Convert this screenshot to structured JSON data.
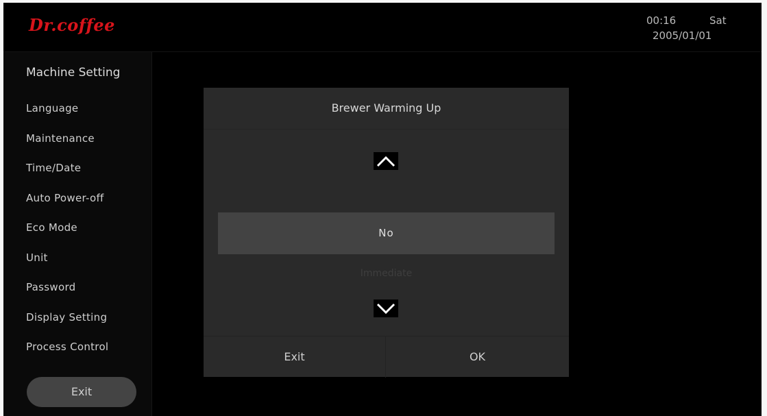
{
  "header": {
    "logo": "Dr.coffee",
    "time": "00:16",
    "day": "Sat",
    "date": "2005/01/01",
    "brand_color": "#d8141b"
  },
  "sidebar": {
    "title": "Machine Setting",
    "items": [
      {
        "label": "Language"
      },
      {
        "label": "Maintenance"
      },
      {
        "label": "Time/Date"
      },
      {
        "label": "Auto Power-off"
      },
      {
        "label": "Eco Mode"
      },
      {
        "label": "Unit"
      },
      {
        "label": "Password"
      },
      {
        "label": "Display Setting"
      },
      {
        "label": "Process Control"
      }
    ],
    "exit_label": "Exit"
  },
  "dialog": {
    "title": "Brewer Warming Up",
    "up_icon": "chevron-up-icon",
    "down_icon": "chevron-down-icon",
    "selected_value": "No",
    "next_option": "Immediate",
    "exit_label": "Exit",
    "ok_label": "OK"
  }
}
